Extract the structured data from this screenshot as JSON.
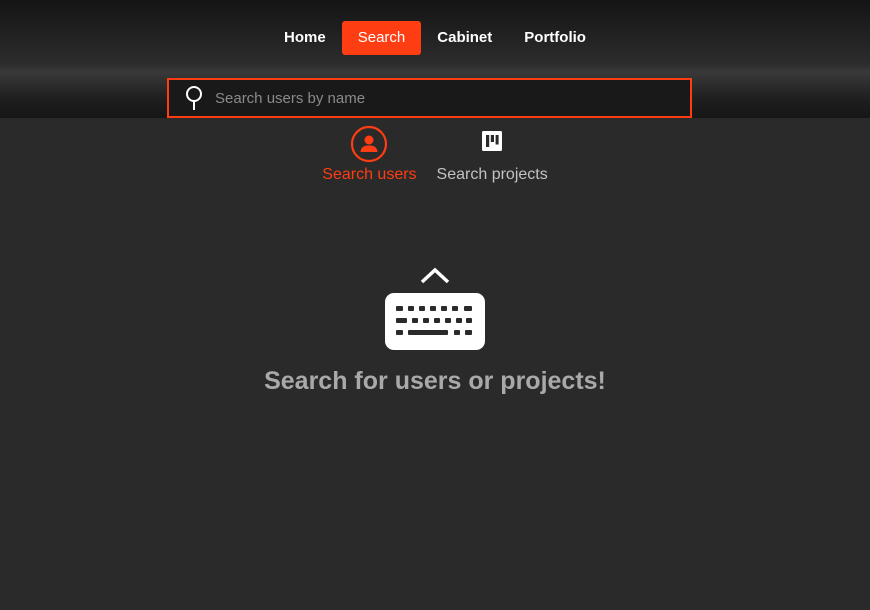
{
  "nav": {
    "items": [
      {
        "label": "Home",
        "active": false
      },
      {
        "label": "Search",
        "active": true
      },
      {
        "label": "Cabinet",
        "active": false
      },
      {
        "label": "Portfolio",
        "active": false
      }
    ]
  },
  "search": {
    "placeholder": "Search users by name",
    "value": "",
    "icon": "search-icon"
  },
  "tabs": [
    {
      "label": "Search users",
      "icon": "user-icon",
      "active": true
    },
    {
      "label": "Search projects",
      "icon": "board-icon",
      "active": false
    }
  ],
  "empty_state": {
    "icon": "keyboard-icon",
    "message": "Search for users or projects!"
  },
  "colors": {
    "accent": "#ff3d12",
    "background": "#2a2a2a",
    "muted_text": "#a9a9a9"
  }
}
